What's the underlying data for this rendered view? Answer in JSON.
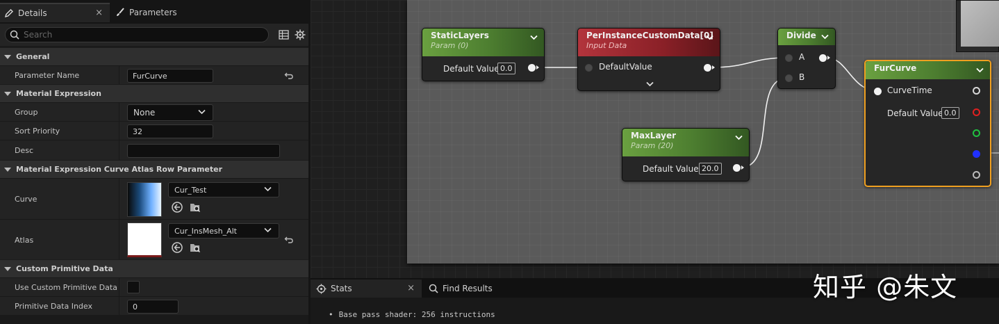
{
  "tabs": {
    "details": "Details",
    "parameters": "Parameters",
    "close_glyph": "×"
  },
  "search": {
    "placeholder": "Search"
  },
  "icons": {
    "details_tab": "pencil-icon",
    "parameters_tab": "brush-icon",
    "table_view": "table-icon",
    "settings": "gear-icon",
    "reset": "reset-arrow-icon",
    "browse": "browse-back-icon",
    "find_in_browser": "folder-search-icon",
    "stats_tab": "stats-icon",
    "find_results_tab": "search-icon"
  },
  "categories": {
    "general": "General",
    "material_expression": "Material Expression",
    "curve_atlas": "Material Expression Curve Atlas Row Parameter",
    "custom_primitive": "Custom Primitive Data"
  },
  "props": {
    "parameter_name": {
      "label": "Parameter Name",
      "value": "FurCurve"
    },
    "group": {
      "label": "Group",
      "value": "None"
    },
    "sort_priority": {
      "label": "Sort Priority",
      "value": "32"
    },
    "desc": {
      "label": "Desc",
      "value": ""
    },
    "curve": {
      "label": "Curve",
      "value": "Cur_Test"
    },
    "atlas": {
      "label": "Atlas",
      "value": "Cur_InsMesh_Alt"
    },
    "use_custom_primitive": {
      "label": "Use Custom Primitive Data",
      "checked": false
    },
    "primitive_data_index": {
      "label": "Primitive Data Index",
      "value": "0"
    }
  },
  "nodes": {
    "static_layers": {
      "title": "StaticLayers",
      "subtitle": "Param (0)",
      "label": "Default Value",
      "value": "0.0"
    },
    "per_instance": {
      "title": "PerInstanceCustomData[0]",
      "subtitle": "Input Data",
      "label": "DefaultValue"
    },
    "divide": {
      "title": "Divide",
      "pin_a": "A",
      "pin_b": "B"
    },
    "max_layer": {
      "title": "MaxLayer",
      "subtitle": "Param (20)",
      "label": "Default Value",
      "value": "20.0"
    },
    "fur_curve": {
      "title": "FurCurve",
      "curve_time": "CurveTime",
      "label": "Default Value",
      "value": "0.0"
    }
  },
  "pin_colors": {
    "red": "#e02020",
    "green": "#20c040",
    "blue": "#2030ff",
    "white": "#d8d8d8"
  },
  "bottom": {
    "stats_tab": "Stats",
    "find_results_tab": "Find Results",
    "bullet": "•",
    "stats_line": "Base pass shader: 256 instructions"
  },
  "watermark": "知乎 @朱文"
}
